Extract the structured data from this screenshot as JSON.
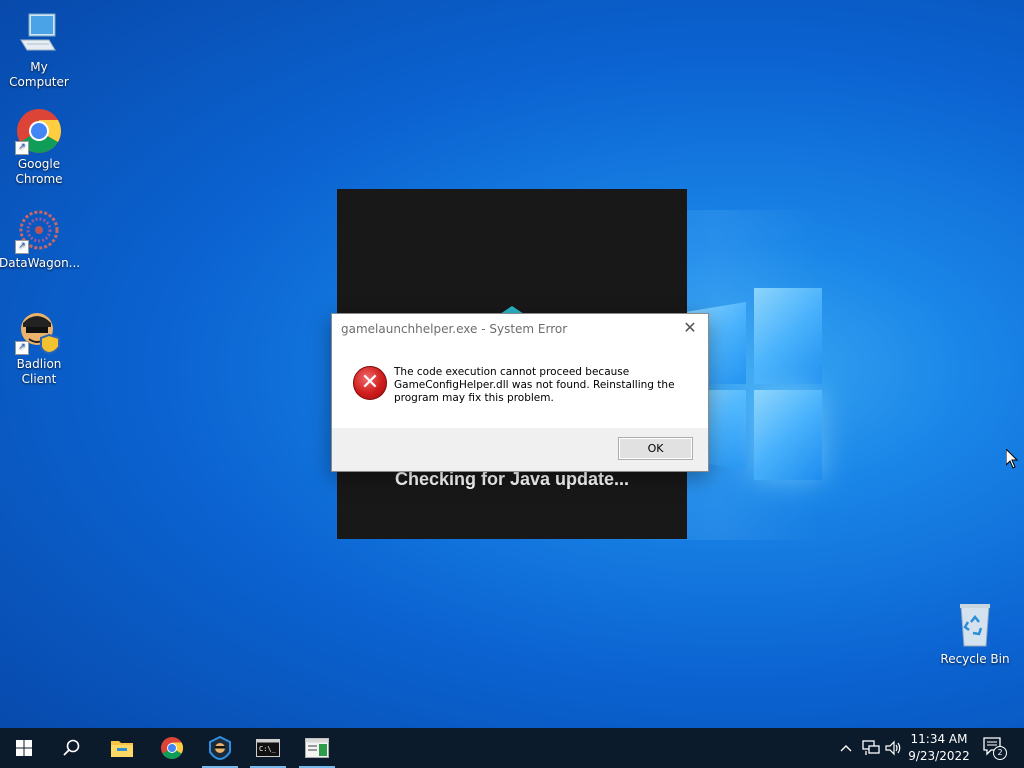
{
  "desktop": {
    "icons": [
      {
        "label": "My Computer",
        "icon": "computer-icon"
      },
      {
        "label": "Google Chrome",
        "icon": "chrome-icon"
      },
      {
        "label": "DataWagon...",
        "icon": "datawagon-icon"
      },
      {
        "label": "Badlion Client",
        "icon": "badlion-icon"
      },
      {
        "label": "Recycle Bin",
        "icon": "recycle-bin-icon"
      }
    ]
  },
  "splash": {
    "message": "Checking for Java update..."
  },
  "dialog": {
    "title": "gamelaunchhelper.exe - System Error",
    "message": "The code execution cannot proceed because GameConfigHelper.dll was not found. Reinstalling the program may fix this problem.",
    "ok_label": "OK",
    "icon": "error-icon"
  },
  "taskbar": {
    "apps": [
      "start-icon",
      "search-icon",
      "file-explorer-icon",
      "chrome-icon",
      "badlion-icon",
      "terminal-icon",
      "window-app-icon"
    ],
    "tray": {
      "time": "11:34 AM",
      "date": "9/23/2022",
      "notification_count": "2"
    }
  },
  "colors": {
    "desktop_bg": "#0b63d1",
    "taskbar_bg": "#0c1b2b",
    "splash_bg": "#181818",
    "error_red": "#d01c1c"
  }
}
